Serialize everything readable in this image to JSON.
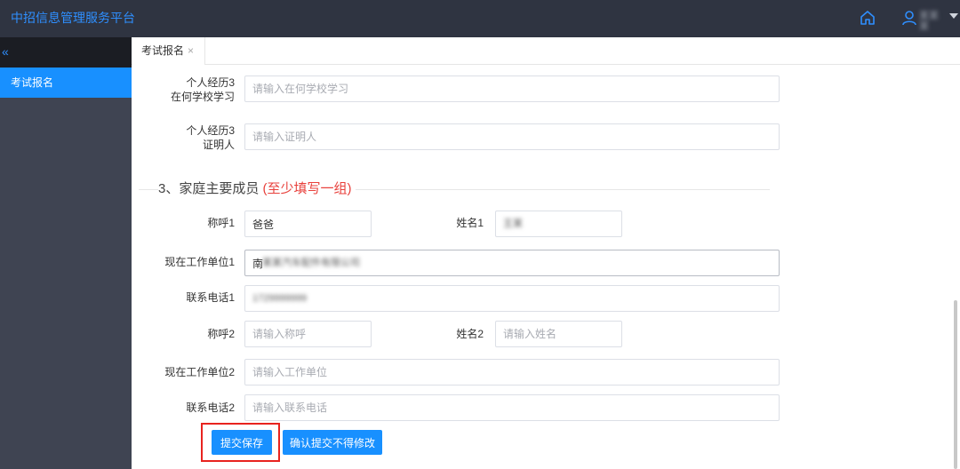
{
  "header": {
    "brand": "中招信息管理服务平台",
    "home_icon": "home-icon",
    "user_icon": "user-icon",
    "user_name": "某某某"
  },
  "sidebar": {
    "collapse_glyph": "«",
    "items": [
      {
        "label": "考试报名",
        "active": true
      }
    ]
  },
  "tabs": [
    {
      "label": "考试报名",
      "close_glyph": "×"
    }
  ],
  "form": {
    "exp3_school": {
      "label_line1": "个人经历3",
      "label_line2": "在何学校学习",
      "placeholder": "请输入在何学校学习",
      "value": ""
    },
    "exp3_witness": {
      "label_line1": "个人经历3",
      "label_line2": "证明人",
      "placeholder": "请输入证明人",
      "value": ""
    },
    "section": {
      "title": "3、家庭主要成员 ",
      "note": "(至少填写一组)"
    },
    "member1": {
      "title_label": "称呼1",
      "title_value": "爸爸",
      "title_placeholder": "请输入称呼",
      "name_label": "姓名1",
      "name_value": "",
      "name_blurred": "王某",
      "work_label": "现在工作单位1",
      "work_prefix": "南",
      "work_blurred": "某某汽车配件有限公司",
      "phone_label": "联系电话1",
      "phone_blurred": "1729999999"
    },
    "member2": {
      "title_label": "称呼2",
      "title_placeholder": "请输入称呼",
      "name_label": "姓名2",
      "name_placeholder": "请输入姓名",
      "work_label": "现在工作单位2",
      "work_placeholder": "请输入工作单位",
      "phone_label": "联系电话2",
      "phone_placeholder": "请输入联系电话"
    }
  },
  "buttons": {
    "save": "提交保存",
    "confirm": "确认提交不得修改"
  },
  "colors": {
    "header_bg": "#2f3441",
    "brand": "#2f8fff",
    "sidebar_bg": "#3f4452",
    "active_item": "#1890ff",
    "accent_red": "#e8413c",
    "button_bg": "#1890ff"
  }
}
